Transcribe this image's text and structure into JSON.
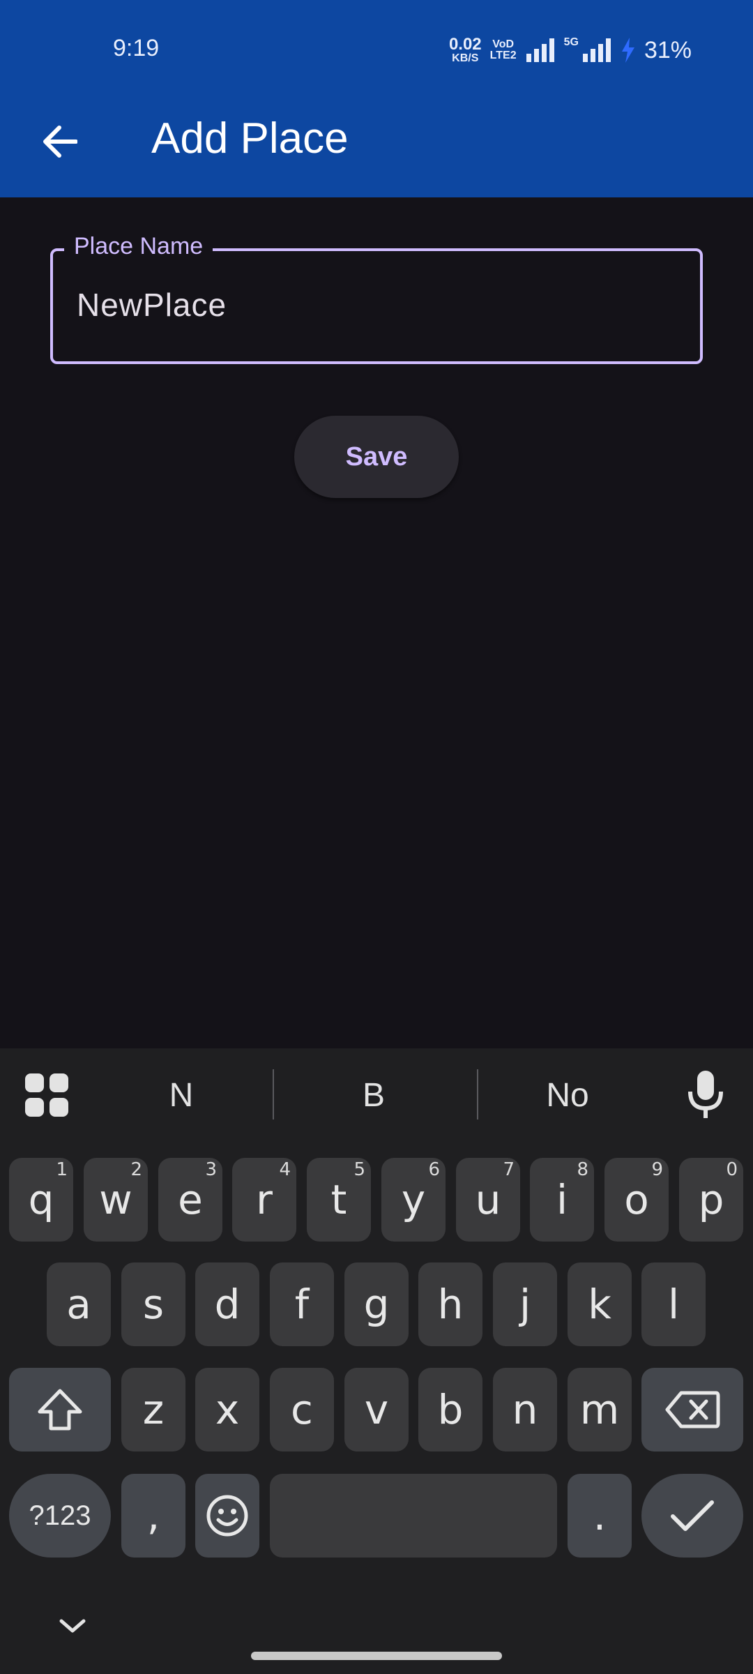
{
  "status_bar": {
    "time": "9:19",
    "net_speed_value": "0.02",
    "net_speed_unit": "KB/S",
    "volte_top": "VoD",
    "volte_bottom": "LTE2",
    "network_type": "5G",
    "battery": "31%",
    "icons": [
      "signal-icon",
      "signal-icon",
      "charging-bolt-icon"
    ]
  },
  "app_bar": {
    "title": "Add Place",
    "background": "#0d47a1",
    "back_icon": "arrow-left-icon"
  },
  "form": {
    "place_name_label": "Place Name",
    "place_name_value": "NewPlace",
    "save_label": "Save",
    "accent": "#d0bcff"
  },
  "keyboard": {
    "suggestions": [
      "N",
      "B",
      "No"
    ],
    "row1": [
      {
        "key": "q",
        "hint": "1"
      },
      {
        "key": "w",
        "hint": "2"
      },
      {
        "key": "e",
        "hint": "3"
      },
      {
        "key": "r",
        "hint": "4"
      },
      {
        "key": "t",
        "hint": "5"
      },
      {
        "key": "y",
        "hint": "6"
      },
      {
        "key": "u",
        "hint": "7"
      },
      {
        "key": "i",
        "hint": "8"
      },
      {
        "key": "o",
        "hint": "9"
      },
      {
        "key": "p",
        "hint": "0"
      }
    ],
    "row2": [
      "a",
      "s",
      "d",
      "f",
      "g",
      "h",
      "j",
      "k",
      "l"
    ],
    "row3": [
      "z",
      "x",
      "c",
      "v",
      "b",
      "n",
      "m"
    ],
    "symbols_label": "?123",
    "comma_label": ",",
    "period_label": ".",
    "icons": [
      "apps-grid-icon",
      "microphone-icon",
      "shift-icon",
      "backspace-icon",
      "emoji-icon",
      "checkmark-icon",
      "chevron-down-icon"
    ]
  }
}
